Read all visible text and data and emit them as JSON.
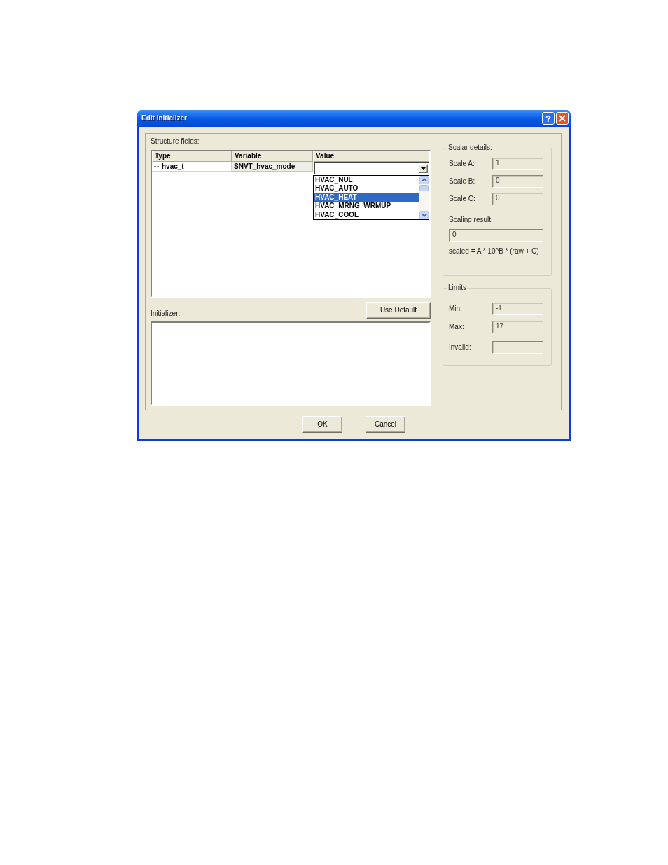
{
  "window": {
    "title": "Edit Initializer",
    "help_button": "?"
  },
  "structure_fields": {
    "label": "Structure fields:",
    "columns": [
      "Type",
      "Variable",
      "Value"
    ],
    "rows": [
      {
        "type": "hvac_t",
        "variable": "SNVT_hvac_mode",
        "value_dropdown": {
          "expanded": true,
          "options": [
            {
              "label": "HVAC_NUL",
              "selected": false
            },
            {
              "label": "HVAC_AUTO",
              "selected": false
            },
            {
              "label": "HVAC_HEAT",
              "selected": true
            },
            {
              "label": "HVAC_MRNG_WRMUP",
              "selected": false
            },
            {
              "label": "HVAC_COOL",
              "selected": false
            }
          ]
        }
      }
    ]
  },
  "use_default_button": "Use Default",
  "initializer": {
    "label": "Initializer:"
  },
  "scalar_details": {
    "title": "Scalar details:",
    "fields": [
      {
        "label": "Scale A:",
        "value": "1"
      },
      {
        "label": "Scale B:",
        "value": "0"
      },
      {
        "label": "Scale C:",
        "value": "0"
      }
    ],
    "result": {
      "label": "Scaling result:",
      "value": "0"
    },
    "formula": "scaled = A * 10^B * (raw + C)"
  },
  "limits": {
    "title": "Limits",
    "fields": [
      {
        "label": "Min:",
        "value": "-1"
      },
      {
        "label": "Max:",
        "value": "17"
      },
      {
        "label": "Invalid:"
      }
    ]
  },
  "buttons": [
    "OK",
    "Cancel"
  ]
}
